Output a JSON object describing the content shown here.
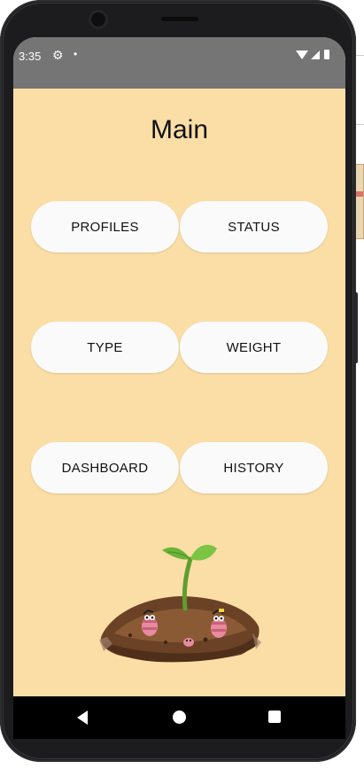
{
  "status_bar": {
    "time": "3:35"
  },
  "page": {
    "title": "Main"
  },
  "buttons": {
    "profiles": "PROFILES",
    "status": "STATUS",
    "type": "TYPE",
    "weight": "WEIGHT",
    "dashboard": "DASHBOARD",
    "history": "HISTORY"
  },
  "icons": {
    "settings": "gear-icon",
    "notification": "dot-icon",
    "wifi": "wifi-icon",
    "signal": "signal-icon",
    "battery": "battery-icon",
    "back": "back-icon",
    "home": "home-icon",
    "recents": "recents-icon"
  },
  "colors": {
    "screen_background": "#fbdea6",
    "status_bar": "#757575",
    "button_background": "#fafafa",
    "nav_bar": "#000000"
  }
}
